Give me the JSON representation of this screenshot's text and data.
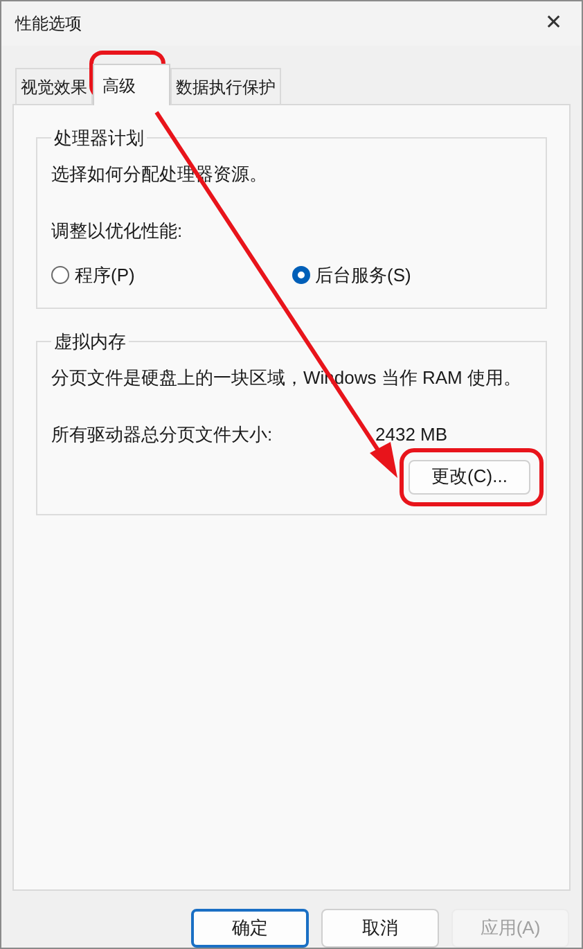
{
  "window": {
    "title": "性能选项",
    "close": "✕"
  },
  "tabs": [
    {
      "label": "视觉效果",
      "selected": false
    },
    {
      "label": "高级",
      "selected": true
    },
    {
      "label": "数据执行保护",
      "selected": false
    }
  ],
  "processor_scheduling": {
    "title": "处理器计划",
    "description": "选择如何分配处理器资源。",
    "prompt": "调整以优化性能:",
    "options": [
      {
        "label": "程序(P)",
        "selected": false
      },
      {
        "label": "后台服务(S)",
        "selected": true
      }
    ]
  },
  "virtual_memory": {
    "title": "虚拟内存",
    "description": "分页文件是硬盘上的一块区域，Windows 当作 RAM 使用。",
    "total_label": "所有驱动器总分页文件大小:",
    "total_value": "2432 MB",
    "change_button": "更改(C)..."
  },
  "buttons": [
    {
      "label": "确定",
      "default": true,
      "disabled": false
    },
    {
      "label": "取消",
      "default": false,
      "disabled": false
    },
    {
      "label": "应用(A)",
      "default": false,
      "disabled": true
    }
  ]
}
